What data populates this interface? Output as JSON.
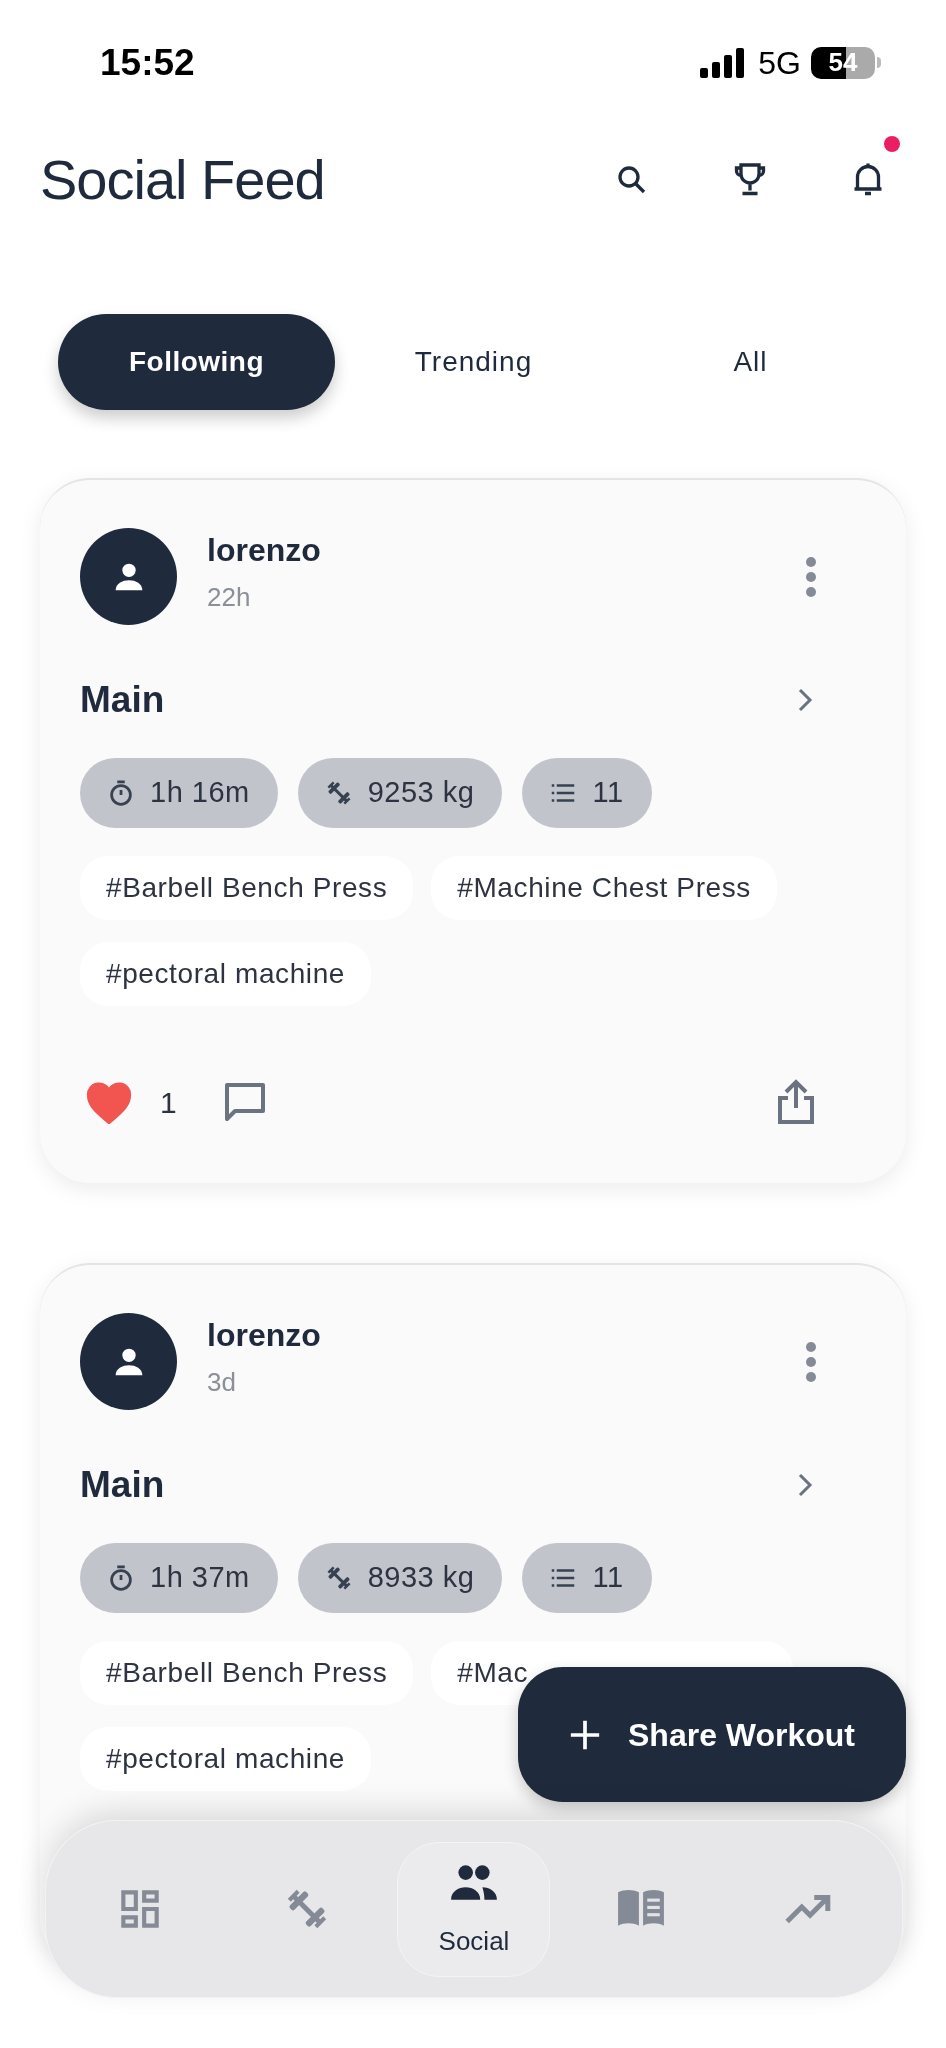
{
  "status_bar": {
    "time": "15:52",
    "network": "5G",
    "battery": "54"
  },
  "header": {
    "title": "Social Feed",
    "notification_badge": true
  },
  "tabs": [
    {
      "label": "Following",
      "selected": true
    },
    {
      "label": "Trending",
      "selected": false
    },
    {
      "label": "All",
      "selected": false
    }
  ],
  "posts": [
    {
      "user": "lorenzo",
      "time": "22h",
      "workout": "Main",
      "stats": [
        {
          "kind": "duration",
          "value": "1h 16m"
        },
        {
          "kind": "volume",
          "value": "9253 kg"
        },
        {
          "kind": "exercises",
          "value": "11"
        }
      ],
      "tags": [
        "#Barbell Bench Press",
        "#Machine Chest Press",
        "#pectoral machine"
      ],
      "liked": true,
      "likes": "1"
    },
    {
      "user": "lorenzo",
      "time": "3d",
      "workout": "Main",
      "stats": [
        {
          "kind": "duration",
          "value": "1h 37m"
        },
        {
          "kind": "volume",
          "value": "8933 kg"
        },
        {
          "kind": "exercises",
          "value": "11"
        }
      ],
      "tags": [
        "#Barbell Bench Press",
        "#Mac",
        "#pectoral machine"
      ]
    }
  ],
  "fab": {
    "label": "Share Workout"
  },
  "bottom_nav": [
    {
      "kind": "dashboard",
      "selected": false
    },
    {
      "kind": "workouts",
      "selected": false
    },
    {
      "kind": "social",
      "label": "Social",
      "selected": true
    },
    {
      "kind": "library",
      "selected": false
    },
    {
      "kind": "progress",
      "selected": false
    }
  ]
}
